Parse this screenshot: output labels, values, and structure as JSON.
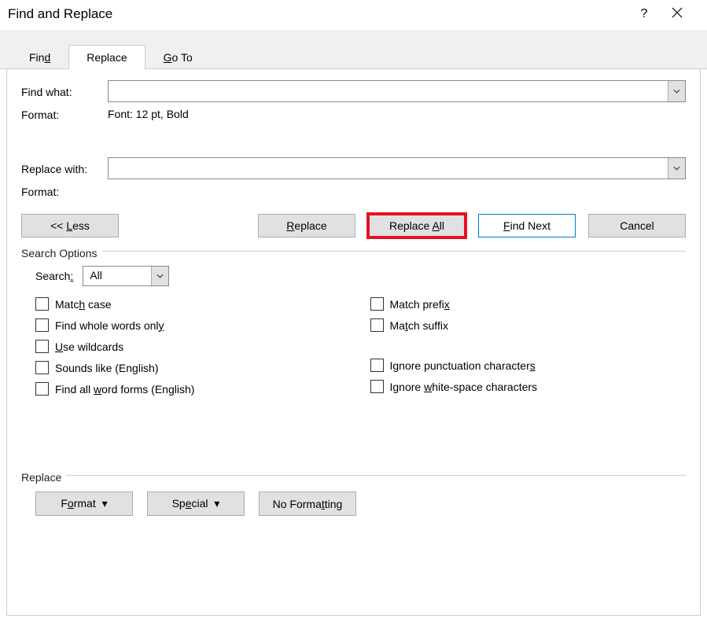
{
  "title": "Find and Replace",
  "titlebar": {
    "help": "?",
    "close": "✕"
  },
  "tabs": {
    "find": "Find",
    "replace": "Replace",
    "goto": "Go To"
  },
  "labels": {
    "findWhat": "Find what:",
    "format": "Format:",
    "replaceWith": "Replace with:",
    "searchOptions": "Search Options",
    "search": "Search:",
    "replaceGroup": "Replace"
  },
  "values": {
    "findFormat": "Font: 12 pt, Bold",
    "replaceFormat": "",
    "findWhat": "",
    "replaceWith": "",
    "searchDir": "All"
  },
  "buttons": {
    "less": "<< Less",
    "replace": "Replace",
    "replaceAll": "Replace All",
    "findNext": "Find Next",
    "cancel": "Cancel",
    "formatBtn": "Format",
    "special": "Special",
    "noFormatting": "No Formatting"
  },
  "checks": {
    "matchCase": "Match case",
    "wholeWords": "Find whole words only",
    "wildcards": "Use wildcards",
    "soundsLike": "Sounds like (English)",
    "wordForms": "Find all word forms (English)",
    "matchPrefix": "Match prefix",
    "matchSuffix": "Match suffix",
    "ignorePunct": "Ignore punctuation characters",
    "ignoreWhite": "Ignore white-space characters"
  }
}
